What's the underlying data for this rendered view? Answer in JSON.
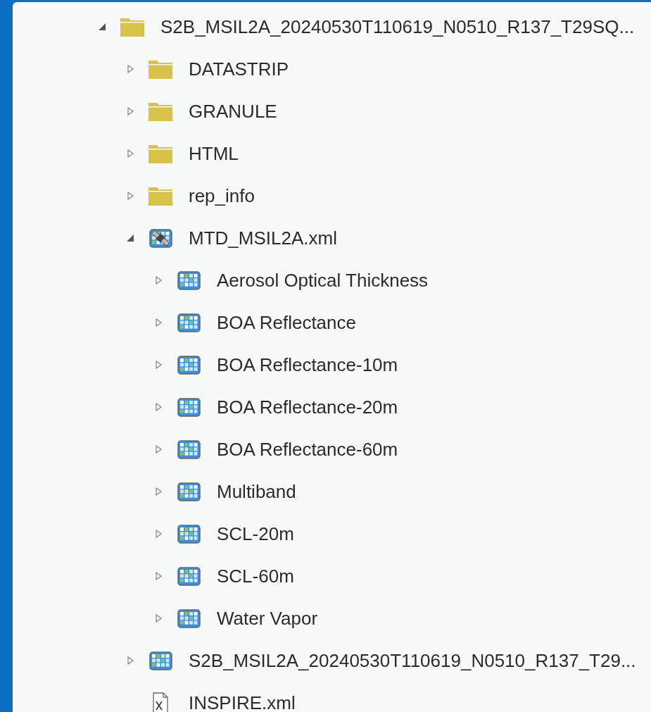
{
  "tree": [
    {
      "label": "S2B_MSIL2A_20240530T110619_N0510_R137_T29SQ...",
      "kind": "folder",
      "expanded": true,
      "children": [
        {
          "label": "DATASTRIP",
          "kind": "folder",
          "expanded": false
        },
        {
          "label": "GRANULE",
          "kind": "folder",
          "expanded": false
        },
        {
          "label": "HTML",
          "kind": "folder",
          "expanded": false
        },
        {
          "label": "rep_info",
          "kind": "folder",
          "expanded": false
        },
        {
          "label": "MTD_MSIL2A.xml",
          "kind": "satellite",
          "expanded": true,
          "children": [
            {
              "label": "Aerosol Optical Thickness",
              "kind": "raster",
              "expanded": false
            },
            {
              "label": "BOA Reflectance",
              "kind": "raster",
              "expanded": false
            },
            {
              "label": "BOA Reflectance-10m",
              "kind": "raster",
              "expanded": false
            },
            {
              "label": "BOA Reflectance-20m",
              "kind": "raster",
              "expanded": false
            },
            {
              "label": "BOA Reflectance-60m",
              "kind": "raster",
              "expanded": false
            },
            {
              "label": "Multiband",
              "kind": "raster",
              "expanded": false
            },
            {
              "label": "SCL-20m",
              "kind": "raster",
              "expanded": false
            },
            {
              "label": "SCL-60m",
              "kind": "raster",
              "expanded": false
            },
            {
              "label": "Water Vapor",
              "kind": "raster",
              "expanded": false
            }
          ]
        },
        {
          "label": "S2B_MSIL2A_20240530T110619_N0510_R137_T29...",
          "kind": "raster",
          "expanded": false
        },
        {
          "label": "INSPIRE.xml",
          "kind": "xml"
        }
      ]
    }
  ]
}
